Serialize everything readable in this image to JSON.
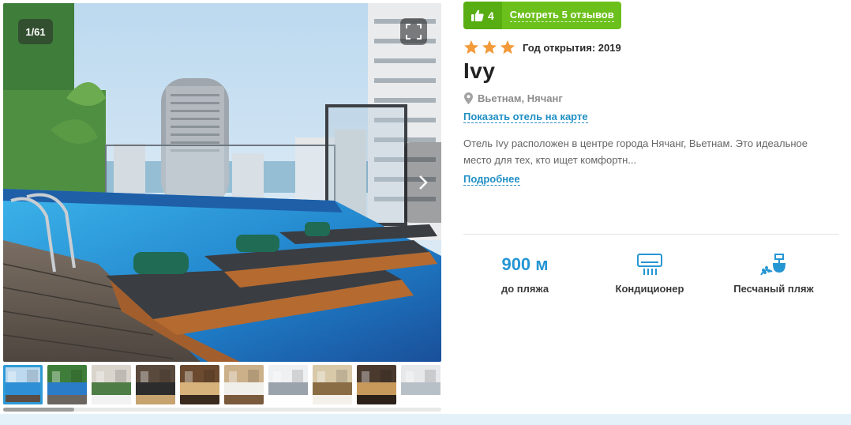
{
  "gallery": {
    "counter": "1/61",
    "fullscreen_icon": "fullscreen-icon",
    "next_icon": "chevron-right-icon",
    "thumbnails": [
      {
        "scene": "pool",
        "active": true
      },
      {
        "scene": "greenwall"
      },
      {
        "scene": "lobby"
      },
      {
        "scene": "corridor"
      },
      {
        "scene": "restaurant"
      },
      {
        "scene": "buffet"
      },
      {
        "scene": "bedroom"
      },
      {
        "scene": "buffet2"
      },
      {
        "scene": "dining"
      },
      {
        "scene": "bedroom2"
      }
    ],
    "scroll_progress": 0.16
  },
  "reviews": {
    "rating": "4",
    "rating_icon": "thumbs-up-icon",
    "link_label": "Смотреть 5 отзывов"
  },
  "hotel": {
    "stars": 3,
    "opening_year": "Год открытия: 2019",
    "name": "Ivy",
    "location": "Вьетнам, Нячанг",
    "location_icon": "map-pin-icon",
    "map_link": "Показать отель на карте",
    "description": "Отель Ivy расположен в центре города Нячанг, Вьетнам. Это идеальное место для тех, кто ищет комфортн...",
    "more_link": "Подробнее"
  },
  "amenities": [
    {
      "value": "900 м",
      "label": "до пляжа"
    },
    {
      "icon": "air-conditioner-icon",
      "label": "Кондиционер"
    },
    {
      "icon": "sandy-beach-icon",
      "label": "Песчаный пляж"
    }
  ],
  "colors": {
    "accent": "#1f8fc4",
    "badge_green": "#6cc01c",
    "star": "#f39a3a",
    "value_blue": "#2696d3"
  }
}
